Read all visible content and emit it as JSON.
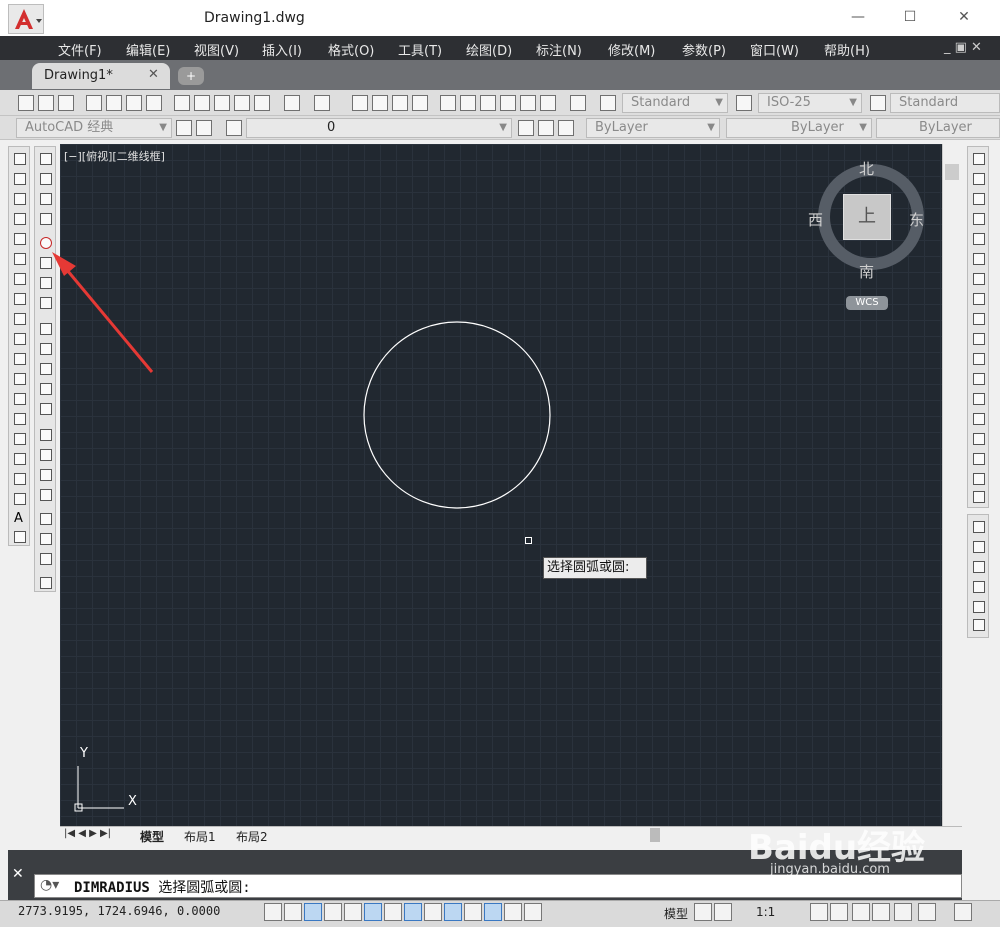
{
  "window": {
    "title": "Drawing1.dwg",
    "minimize": "—",
    "maximize": "☐",
    "close": "✕"
  },
  "menu": [
    "文件(F)",
    "编辑(E)",
    "视图(V)",
    "插入(I)",
    "格式(O)",
    "工具(T)",
    "绘图(D)",
    "标注(N)",
    "修改(M)",
    "参数(P)",
    "窗口(W)",
    "帮助(H)"
  ],
  "doc_tab": {
    "label": "Drawing1*",
    "close": "✕",
    "new_tab": "+"
  },
  "toolbar": {
    "text_style": "Standard",
    "dim_style": "ISO-25",
    "table_style": "Standard",
    "workspace": "AutoCAD 经典",
    "layer": "0",
    "color": "ByLayer",
    "linetype": "ByLayer",
    "lineweight": "ByLayer"
  },
  "viewport": {
    "label": "[−][俯视][二维线框]"
  },
  "viewcube": {
    "top": "上",
    "north": "北",
    "south": "南",
    "east": "东",
    "west": "西",
    "wcs": "WCS"
  },
  "tooltip": {
    "text": "选择圆弧或圆:"
  },
  "ucs": {
    "x": "X",
    "y": "Y"
  },
  "layout_tabs": [
    "模型",
    "布局1",
    "布局2"
  ],
  "command": {
    "name": "DIMRADIUS",
    "prompt": "选择圆弧或圆:"
  },
  "status": {
    "coords": "2773.9195, 1724.6946, 0.0000",
    "model": "模型",
    "scale": "1:1"
  },
  "watermark": {
    "brand": "Baidu经验",
    "site": "jingyan.baidu.com"
  },
  "colors": {
    "canvas": "#212830",
    "menubar": "#2d2f33",
    "accent_arrow": "#e53935",
    "logo_red": "#d32f2f"
  }
}
